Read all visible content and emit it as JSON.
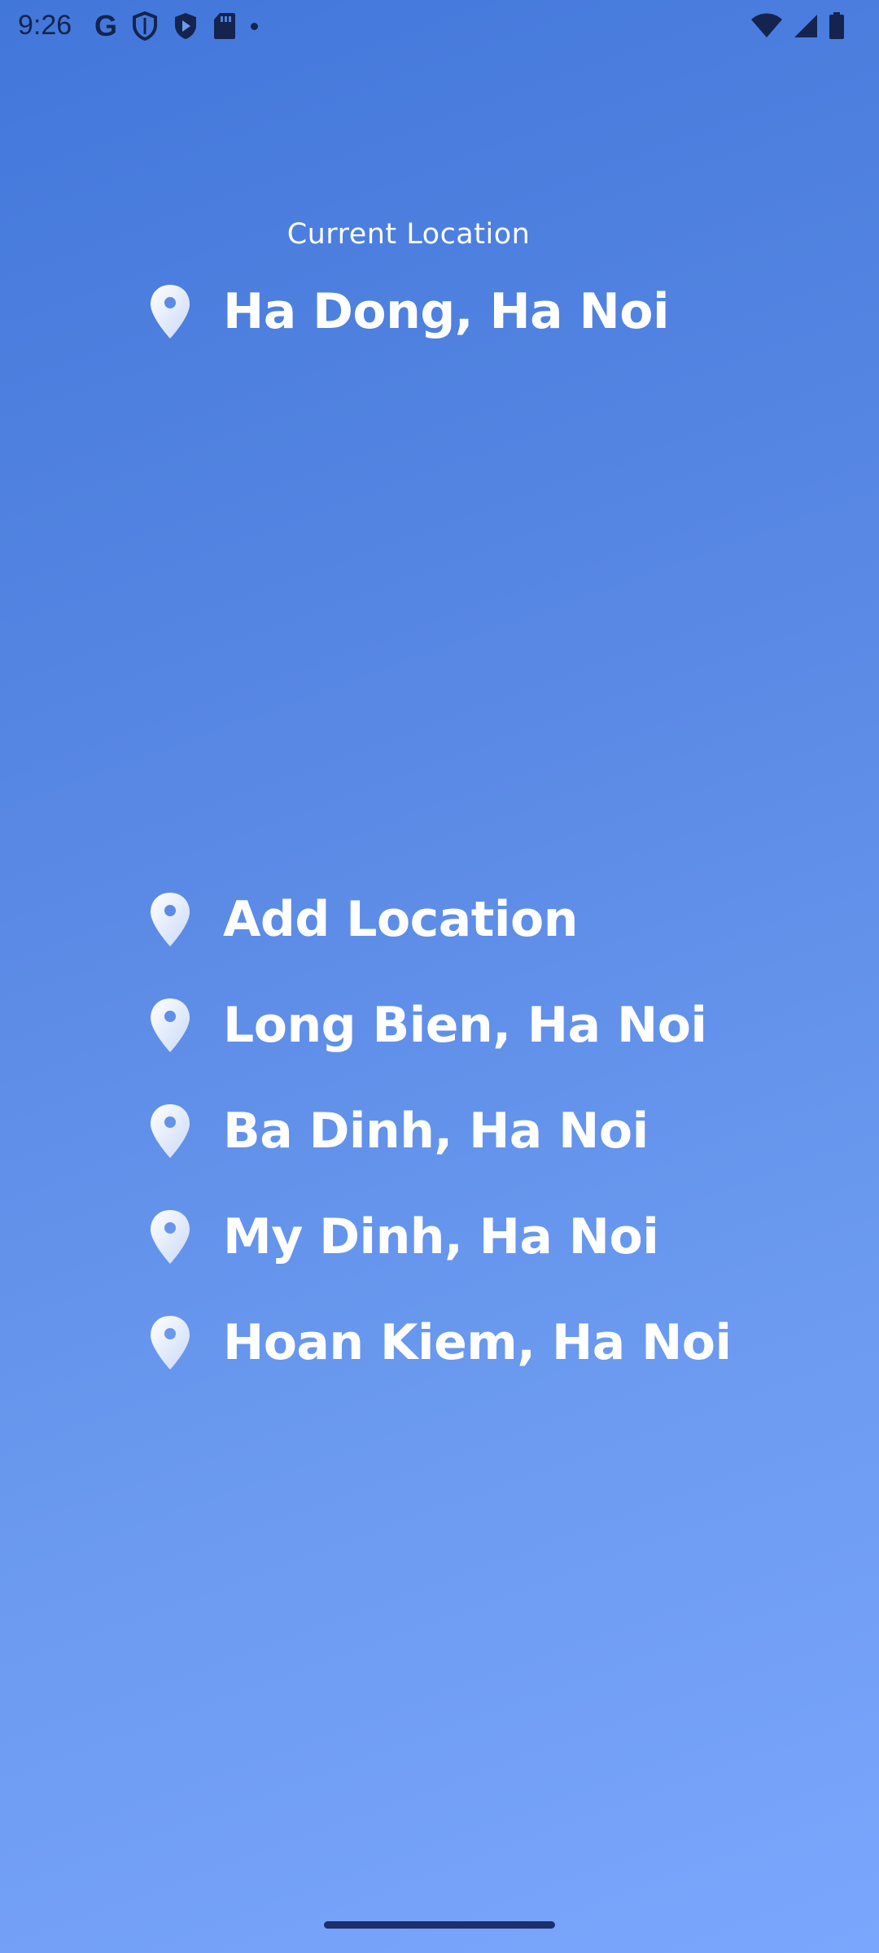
{
  "status_bar": {
    "time": "9:26",
    "left_icons": [
      "google-icon",
      "shield-outline-icon",
      "shield-play-icon",
      "sd-card-icon",
      "dot-icon"
    ],
    "right_icons": [
      "wifi-icon",
      "signal-icon",
      "battery-icon"
    ]
  },
  "current_location": {
    "label": "Current Location",
    "name": "Ha Dong, Ha Noi",
    "icon": "location-pin-icon"
  },
  "locations": [
    {
      "label": "Add Location",
      "icon": "location-pin-icon"
    },
    {
      "label": "Long Bien, Ha Noi",
      "icon": "location-pin-icon"
    },
    {
      "label": "Ba Dinh, Ha Noi",
      "icon": "location-pin-icon"
    },
    {
      "label": "My Dinh, Ha Noi",
      "icon": "location-pin-icon"
    },
    {
      "label": "Hoan Kiem, Ha Noi",
      "icon": "location-pin-icon"
    }
  ],
  "colors": {
    "gradient_top": "#4277da",
    "gradient_bottom": "#7ba6fd",
    "text": "#ffffff",
    "status_icons": "#14244f"
  }
}
